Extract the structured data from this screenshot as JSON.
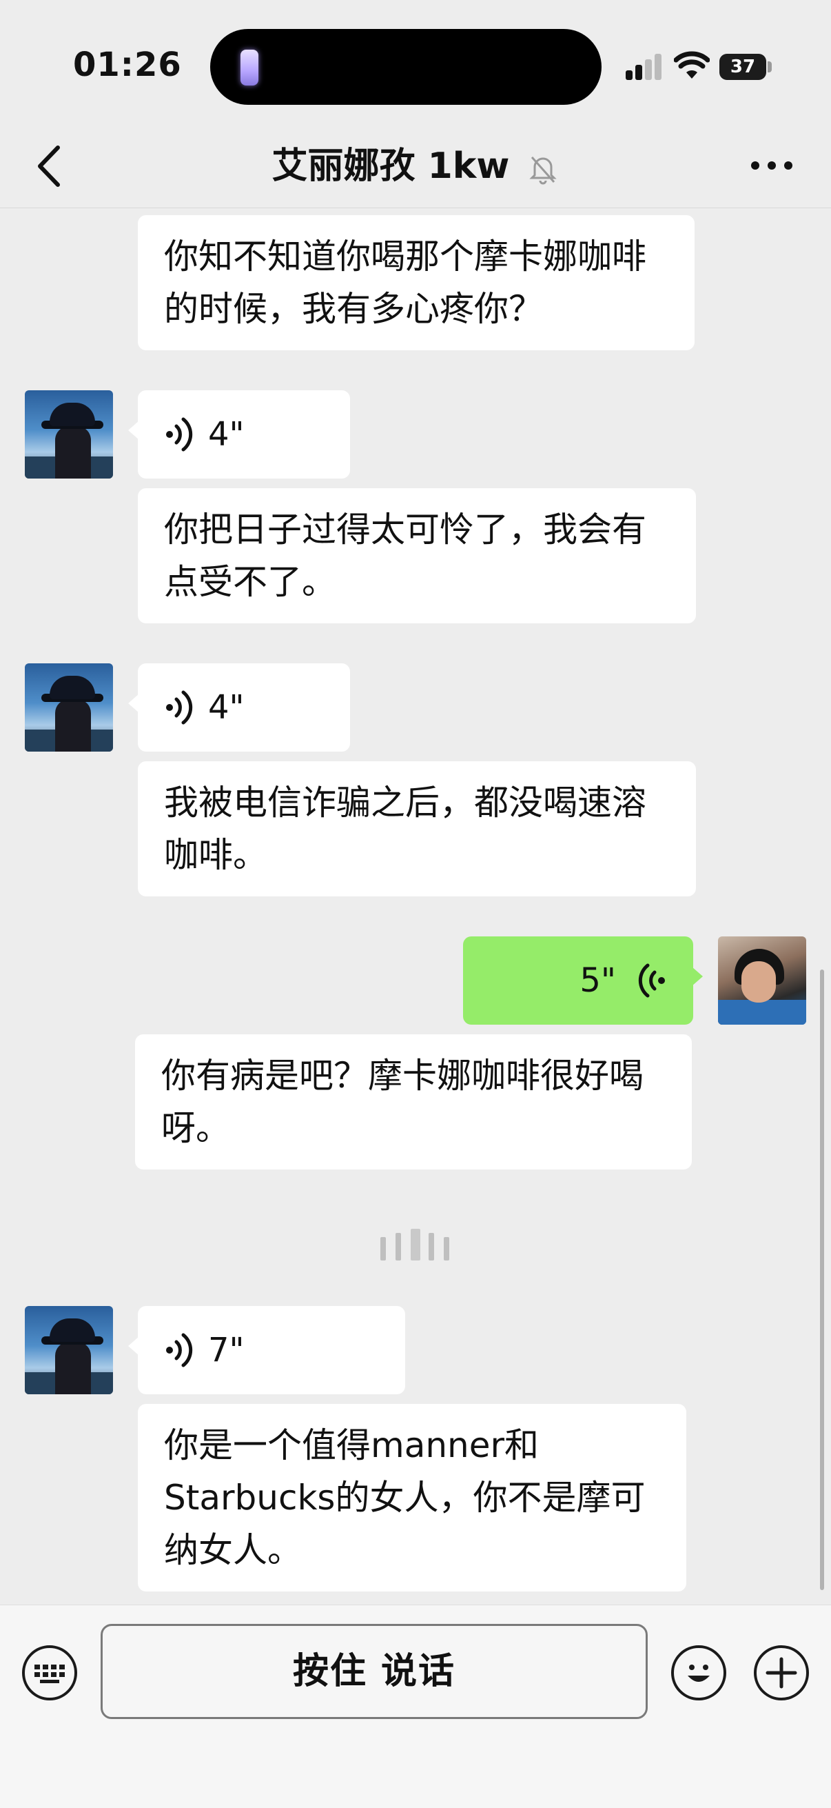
{
  "status_bar": {
    "time": "01:26",
    "battery": "37"
  },
  "header": {
    "title": "艾丽娜孜 1kw"
  },
  "messages": [
    {
      "side": "left",
      "type": "text",
      "text": "你知不知道你喝那个摩卡娜咖啡的时候，我有多心疼你？"
    },
    {
      "side": "left",
      "type": "voice",
      "duration": "4\""
    },
    {
      "side": "left",
      "type": "text",
      "text": "你把日子过得太可怜了，我会有点受不了。"
    },
    {
      "side": "left",
      "type": "voice",
      "duration": "4\""
    },
    {
      "side": "left",
      "type": "text",
      "text": "我被电信诈骗之后，都没喝速溶咖啡。"
    },
    {
      "side": "right",
      "type": "voice",
      "duration": "5\""
    },
    {
      "side": "right",
      "type": "text",
      "text": "你有病是吧？摩卡娜咖啡很好喝呀。"
    },
    {
      "side": "left",
      "type": "voice",
      "duration": "7\""
    },
    {
      "side": "left",
      "type": "text",
      "text": "你是一个值得manner和Starbucks的女人，你不是摩可纳女人。"
    }
  ],
  "input_bar": {
    "hold_to_talk_label": "按住 说话"
  },
  "colors": {
    "background": "#ededed",
    "my_bubble": "#95ec69",
    "their_bubble": "#ffffff"
  },
  "icons": [
    "signal-icon",
    "wifi-icon",
    "battery-icon",
    "back-icon",
    "mute-bell-icon",
    "more-icon",
    "voice-wave-icon",
    "keyboard-icon",
    "emoji-icon",
    "plus-icon"
  ]
}
